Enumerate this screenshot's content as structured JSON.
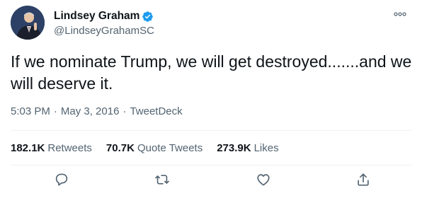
{
  "author": {
    "name": "Lindsey Graham",
    "handle": "@LindseyGrahamSC",
    "verified": true
  },
  "tweet": {
    "text": "If we nominate Trump, we will get destroyed.......and we will deserve it.",
    "time": "5:03 PM",
    "date": "May 3, 2016",
    "source": "TweetDeck",
    "separator": "·"
  },
  "stats": {
    "retweets_count": "182.1K",
    "retweets_label": "Retweets",
    "quotes_count": "70.7K",
    "quotes_label": "Quote Tweets",
    "likes_count": "273.9K",
    "likes_label": "Likes"
  },
  "icons": {
    "more": "more-icon",
    "verified": "verified-badge-icon",
    "reply": "reply-icon",
    "retweet": "retweet-icon",
    "like": "like-icon",
    "share": "share-icon"
  },
  "colors": {
    "verified": "#1d9bf0",
    "secondary_text": "#536471",
    "primary_text": "#0f1419",
    "divider": "#eff3f4"
  }
}
